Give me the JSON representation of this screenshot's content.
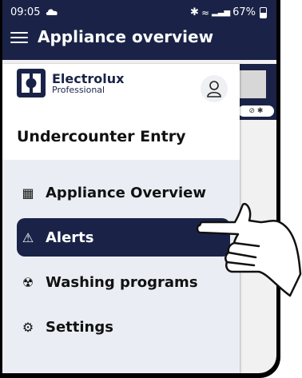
{
  "status": {
    "time": "09:05",
    "battery": "67%"
  },
  "appbar": {
    "title": "Appliance overview",
    "menu_icon": "hamburger-menu-icon"
  },
  "drawer": {
    "brand_line1": "Electrolux",
    "brand_line2": "Professional",
    "appliance_name": "Undercounter Entry",
    "items": [
      {
        "label": "Appliance Overview",
        "icon": "grid-icon",
        "active": false
      },
      {
        "label": "Alerts",
        "icon": "warning-icon",
        "active": true
      },
      {
        "label": "Washing programs",
        "icon": "washing-program-icon",
        "active": false
      },
      {
        "label": "Settings",
        "icon": "gear-icon",
        "active": false
      }
    ]
  },
  "colors": {
    "primary": "#1a2347",
    "drawer_bg": "#eaeef4",
    "text": "#111111"
  }
}
